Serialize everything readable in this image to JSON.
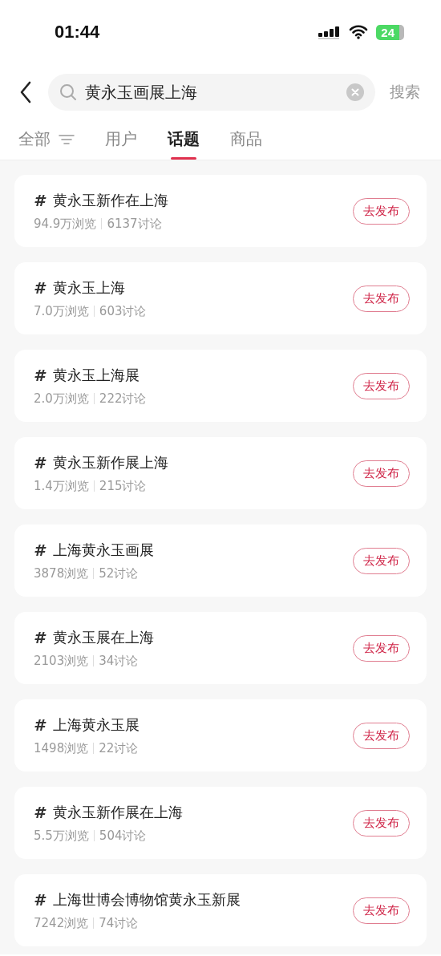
{
  "status_bar": {
    "time": "01:44",
    "battery": "24"
  },
  "search": {
    "value": "黄永玉画展上海",
    "submit": "搜索"
  },
  "tabs": [
    {
      "label": "全部",
      "selected": false,
      "filter": true
    },
    {
      "label": "用户",
      "selected": false
    },
    {
      "label": "话题",
      "selected": true
    },
    {
      "label": "商品",
      "selected": false
    }
  ],
  "topics": [
    {
      "mark": "#",
      "title": "黄永玉新作在上海",
      "views": "94.9万浏览",
      "discussions": "6137讨论",
      "action": "去发布"
    },
    {
      "mark": "#",
      "title": "黄永玉上海",
      "views": "7.0万浏览",
      "discussions": "603讨论",
      "action": "去发布"
    },
    {
      "mark": "#",
      "title": "黄永玉上海展",
      "views": "2.0万浏览",
      "discussions": "222讨论",
      "action": "去发布"
    },
    {
      "mark": "#",
      "title": "黄永玉新作展上海",
      "views": "1.4万浏览",
      "discussions": "215讨论",
      "action": "去发布"
    },
    {
      "mark": "#",
      "title": "上海黄永玉画展",
      "views": "3878浏览",
      "discussions": "52讨论",
      "action": "去发布"
    },
    {
      "mark": "#",
      "title": "黄永玉展在上海",
      "views": "2103浏览",
      "discussions": "34讨论",
      "action": "去发布"
    },
    {
      "mark": "#",
      "title": "上海黄永玉展",
      "views": "1498浏览",
      "discussions": "22讨论",
      "action": "去发布"
    },
    {
      "mark": "#",
      "title": "黄永玉新作展在上海",
      "views": "5.5万浏览",
      "discussions": "504讨论",
      "action": "去发布"
    },
    {
      "mark": "#",
      "title": "上海世博会博物馆黄永玉新展",
      "views": "7242浏览",
      "discussions": "74讨论",
      "action": "去发布"
    }
  ]
}
